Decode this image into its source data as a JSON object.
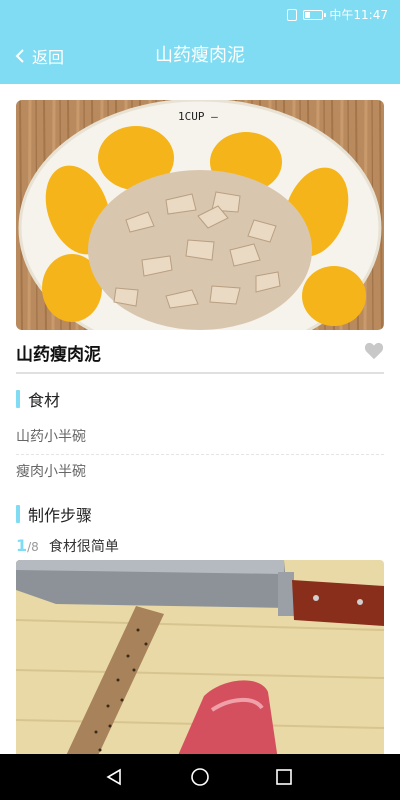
{
  "status_bar": {
    "carrier_time": "中午11:47"
  },
  "header": {
    "back_label": "返回",
    "title": "山药瘦肉泥"
  },
  "recipe": {
    "name": "山药瘦肉泥",
    "ingredients_heading": "食材",
    "ingredients": [
      "山药小半碗",
      "瘦肉小半碗"
    ],
    "steps_heading": "制作步骤",
    "step": {
      "current": "1",
      "total": "/8",
      "text": "食材很简单"
    }
  },
  "colors": {
    "accent": "#7fdcf2",
    "heart": "#c8c8c8"
  },
  "icons": {
    "back": "chevron-left-icon",
    "favorite": "heart-icon",
    "nav_back": "triangle-back-icon",
    "nav_home": "circle-home-icon",
    "nav_recents": "square-recents-icon"
  }
}
